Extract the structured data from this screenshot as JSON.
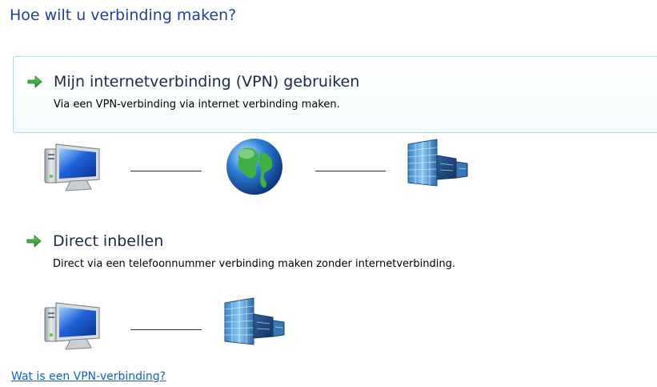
{
  "header": {
    "title": "Hoe wilt u verbinding maken?"
  },
  "options": [
    {
      "title": "Mijn internetverbinding (VPN) gebruiken",
      "description": "Via een VPN-verbinding via internet verbinding maken.",
      "icon": "green-arrow-icon",
      "diagram": [
        "computer-icon",
        "globe-icon",
        "office-building-icon"
      ]
    },
    {
      "title": "Direct inbellen",
      "description": "Direct via een telefoonnummer verbinding maken zonder internetverbinding.",
      "icon": "green-arrow-icon",
      "diagram": [
        "computer-icon",
        "office-building-icon"
      ]
    }
  ],
  "footer": {
    "help_link": "Wat is een VPN-verbinding?"
  },
  "colors": {
    "title": "#1e3f9c",
    "link": "#1560c7",
    "selection_border": "#a9dcf0",
    "arrow": "#2fa63a"
  }
}
